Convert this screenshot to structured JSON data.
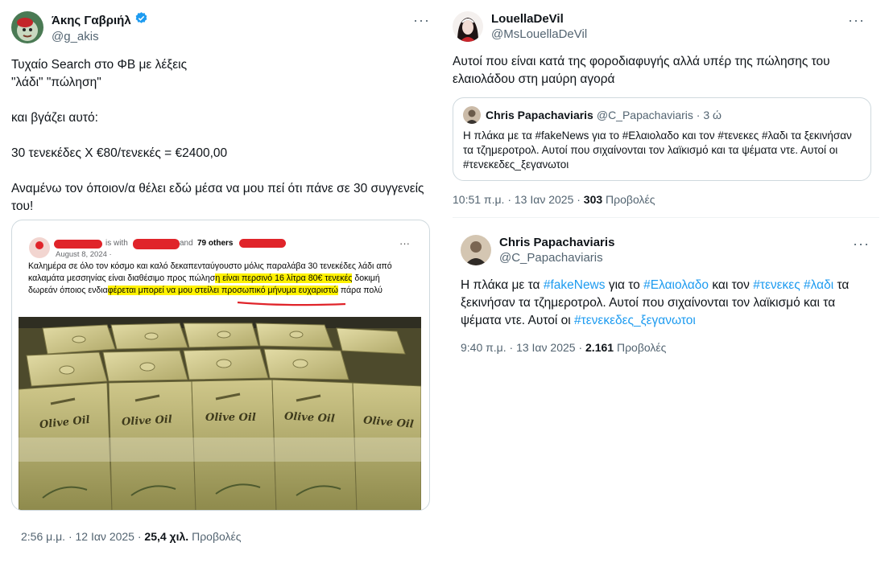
{
  "tweet1": {
    "author_name": "Άκης Γαβριήλ",
    "author_handle": "@g_akis",
    "verified": true,
    "text": "Τυχαίο Search στο ΦΒ με λέξεις\n\"λάδι\" \"πώληση\"\n\nκαι βγάζει αυτό:\n\n30 τενεκέδες Χ €80/τενεκές = €2400,00\n\nΑναμένω τον όποιον/α θέλει εδώ μέσα να μου πεί ότι πάνε σε 30 συγγενείς του!",
    "fb_post": {
      "is_with": "is with",
      "and": "and",
      "others": "79 others",
      "date": "August 8, 2024 · ",
      "text_1": "Καλημέρα σε όλο τον κόσμο και καλό δεκαπενταύγουστο μόλις παραλάβα 30 τενεκέδες λάδι από καλαμάτα μεσσηνίας είναι διαθέσιμο προς πώλησ",
      "text_hl_1": "η είναι περσινό 16 λίτρα 80€ τενεκές",
      "text_2": " δοκιμή δωρεάν όποιος ενδια",
      "text_hl_2": "φέρεται μπορεί να μου στείλει προσωπικό μήνυμα ευχαριστώ",
      "text_3": " πάρα πολύ",
      "can_label": "Olive Oil"
    },
    "time": "2:56 μ.μ. · 12 Ιαν 2025 · ",
    "views": "25,4 χιλ.",
    "views_label": " Προβολές"
  },
  "tweet2": {
    "author_name": "LouellaDeVil",
    "author_handle": "@MsLouellaDeVil",
    "text": "Αυτοί που είναι κατά της φοροδιαφυγής αλλά υπέρ της πώλησης του ελαιολάδου στη μαύρη αγορά",
    "quote": {
      "author_name": "Chris Papachaviaris",
      "author_handle": "@C_Papachaviaris · 3 ώ",
      "text": "Η πλάκα με τα #fakeNews για το #Ελαιολαδο και τον #τενεκες #λαδι τα ξεκινήσαν τα τζημεροτρολ. Αυτοί που σιχαίνονται τον λαϊκισμό και τα ψέματα ντε. Αυτοί οι #τενεκεδες_ξεγανωτοι"
    },
    "time": "10:51 π.μ. · 13 Ιαν 2025 · ",
    "views": "303",
    "views_label": " Προβολές"
  },
  "tweet3": {
    "author_name": "Chris Papachaviaris",
    "author_handle": "@C_Papachaviaris",
    "text_parts": [
      "Η πλάκα με τα ",
      "#fakeNews",
      " για το ",
      "#Ελαιολαδο",
      " και τον ",
      "#τενεκες",
      " ",
      "#λαδι",
      " τα ξεκινήσαν τα τζημεροτρολ. Αυτοί που σιχαίνονται τον λαϊκισμό και τα ψέματα ντε. Αυτοί οι ",
      "#τενεκεδες_ξεγανωτοι"
    ],
    "time": "9:40 π.μ. · 13 Ιαν 2025 · ",
    "views": "2.161",
    "views_label": " Προβολές"
  },
  "more_glyph": "···",
  "colors": {
    "link": "#1d9bf0",
    "secondary": "#536471",
    "verified": "#1d9bf0",
    "highlight": "#fff200",
    "redaction": "#e0242a"
  }
}
